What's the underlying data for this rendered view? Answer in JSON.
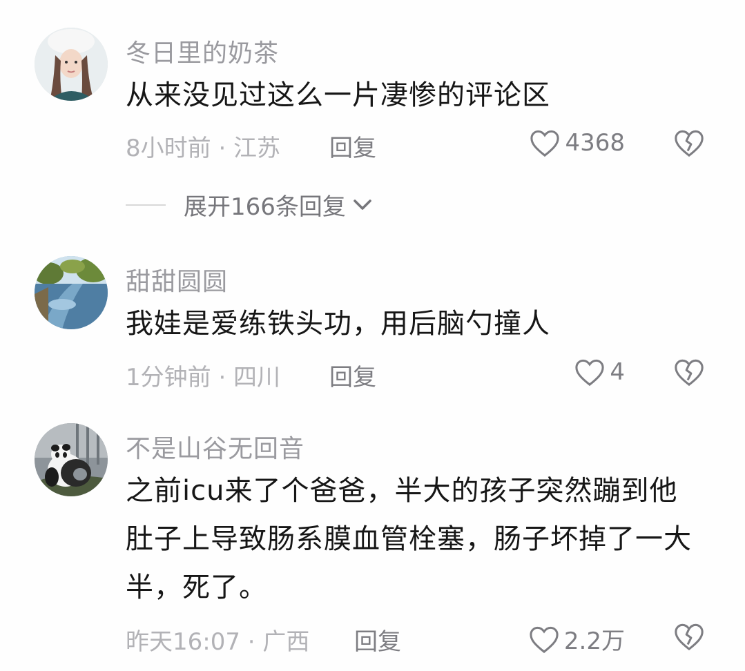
{
  "comments": [
    {
      "username": "冬日里的奶茶",
      "text": "从来没见过这么一片凄惨的评论区",
      "meta": "8小时前 · 江苏",
      "reply_label": "回复",
      "likes": "4368",
      "expand_label": "展开166条回复"
    },
    {
      "username": "甜甜圆圆",
      "text": "我娃是爱练铁头功，用后脑勺撞人",
      "meta": "1分钟前 · 四川",
      "reply_label": "回复",
      "likes": "4"
    },
    {
      "username": "不是山谷无回音",
      "text": "之前icu来了个爸爸，半大的孩子突然蹦到他肚子上导致肠系膜血管栓塞，肠子坏掉了一大半，死了。",
      "meta": "昨天16:07 · 广西",
      "reply_label": "回复",
      "likes": "2.2万"
    }
  ],
  "icons": {
    "like": "heart-outline-icon",
    "dislike": "broken-heart-icon",
    "expand": "chevron-down-icon"
  },
  "colors": {
    "username": "#9a9a9f",
    "text": "#161616",
    "meta": "#b2b2b6",
    "action": "#7d7d82"
  }
}
